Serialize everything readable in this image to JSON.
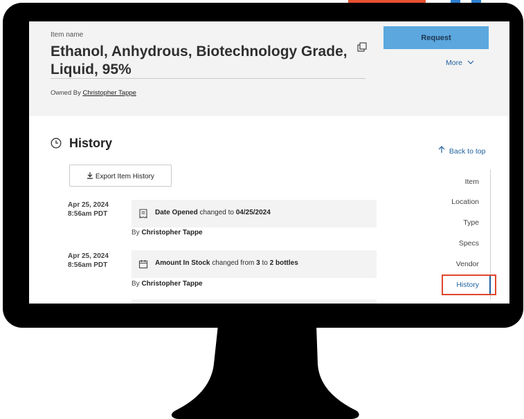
{
  "header": {
    "item_name_label": "Item name",
    "title": "Ethanol, Anhydrous, Biotechnology Grade, Liquid, 95%",
    "owned_prefix": "Owned By",
    "owner": "Christopher Tappe",
    "request_label": "Request",
    "more_label": "More"
  },
  "history": {
    "title": "History",
    "back_to_top": "Back to top",
    "export_label": "Export Item History",
    "by_prefix": "By",
    "events": [
      {
        "date": "Apr 25, 2024",
        "time": "8:56am PDT",
        "field": "Date Opened",
        "changed_to_text": "changed to",
        "new_value": "04/25/2024",
        "by": "Christopher Tappe",
        "icon": "receipt-icon"
      },
      {
        "date": "Apr 25, 2024",
        "time": "8:56am PDT",
        "field": "Amount In Stock",
        "changed_from_text": "changed from",
        "old_value": "3",
        "to_text": "to",
        "new_value": "2 bottles",
        "by": "Christopher Tappe",
        "icon": "calendar-icon"
      }
    ]
  },
  "nav": {
    "items": [
      "Item",
      "Location",
      "Type",
      "Specs",
      "Vendor",
      "History"
    ],
    "active": "History"
  },
  "colors": {
    "accent": "#5ba7de",
    "link": "#1f5f9e",
    "highlight": "#e0452b",
    "panel": "#f3f3f3"
  }
}
